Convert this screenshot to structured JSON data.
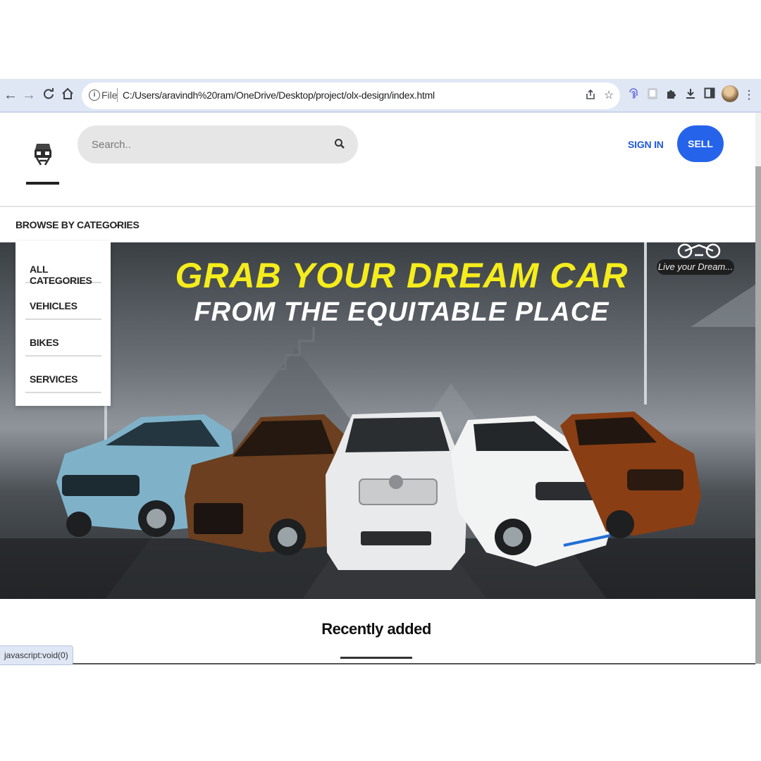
{
  "browser": {
    "file_label": "File",
    "url": "C:/Users/aravindh%20ram/OneDrive/Desktop/project/olx-design/index.html",
    "nav_icons": [
      "back-arrow-icon",
      "forward-arrow-icon",
      "reload-icon",
      "home-icon"
    ],
    "extension_icons": [
      "share-icon",
      "star-icon",
      "fingerprint-icon",
      "extension-card-icon",
      "puzzle-icon",
      "download-icon",
      "sidebar-icon",
      "profile-avatar",
      "kebab-menu-icon"
    ]
  },
  "header": {
    "search_placeholder": "Search..",
    "sign_in": "SIGN IN",
    "sell": "SELL"
  },
  "categories": {
    "browse_label": "BROWSE BY CATEGORIES",
    "items": [
      "ALL CATEGORIES",
      "VEHICLES",
      "BIKES",
      "SERVICES"
    ]
  },
  "hero": {
    "title_line1": "GRAB YOUR DREAM CAR",
    "title_line2": "FROM THE EQUITABLE PLACE",
    "badge": "Live your Dream...",
    "cars": [
      {
        "color": "#7fb2c9"
      },
      {
        "color": "#6b3f1f"
      },
      {
        "color": "#e9eaeb"
      },
      {
        "color": "#f2f3f3"
      },
      {
        "color": "#8a3e14"
      }
    ]
  },
  "main": {
    "recently_added": "Recently added"
  },
  "status_bar": "javascript:void(0)",
  "colors": {
    "accent": "#2563eb",
    "hero_title": "#f5ec1c"
  }
}
